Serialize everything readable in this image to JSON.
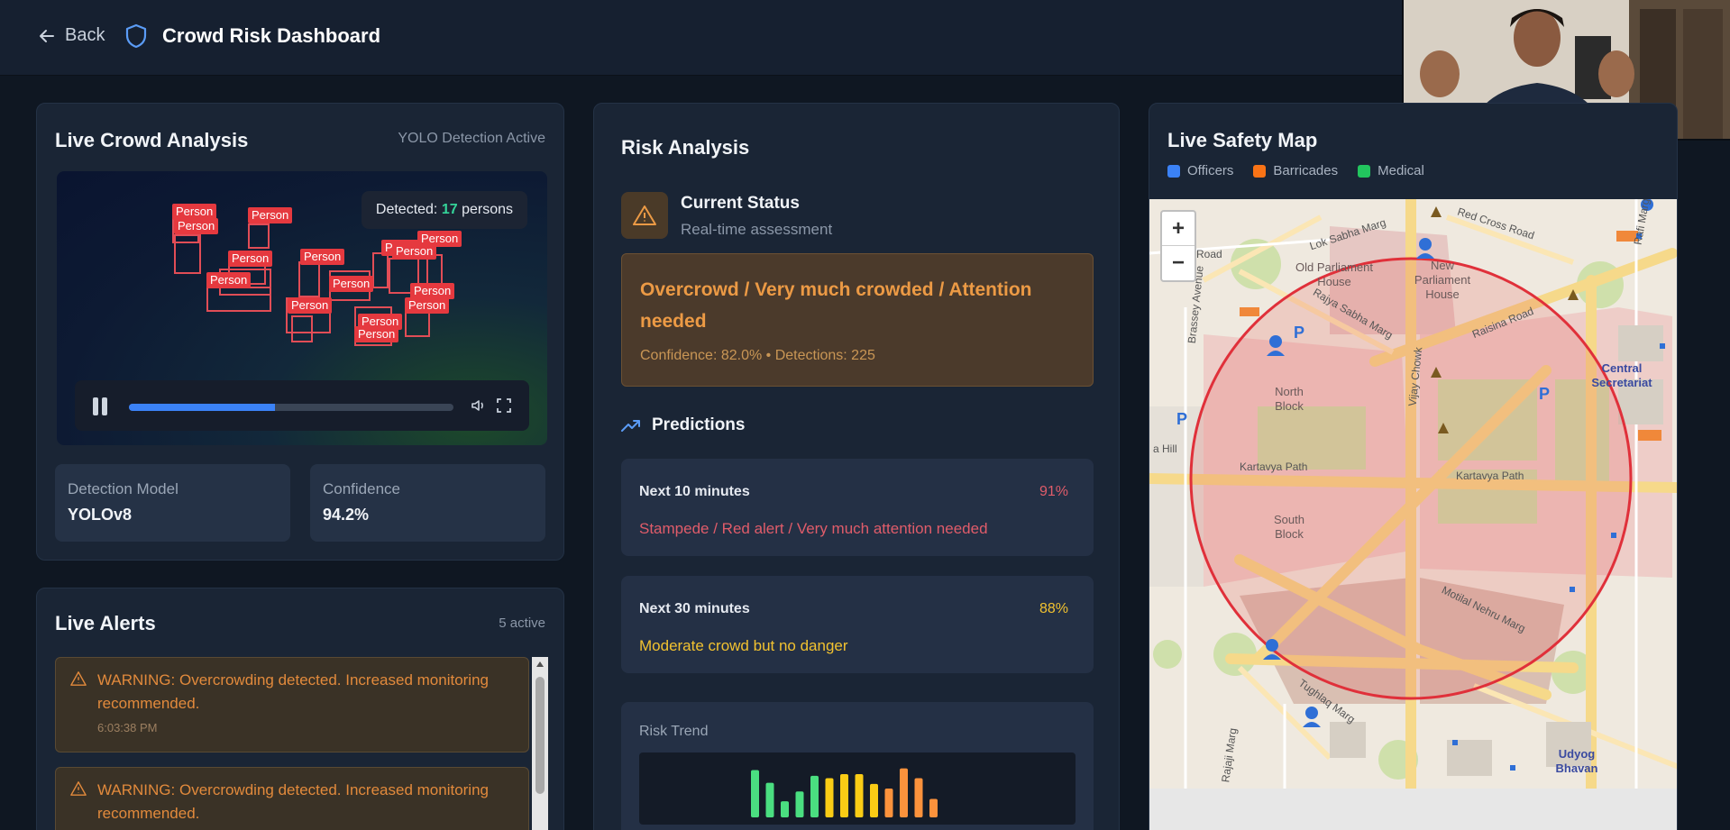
{
  "header": {
    "back_label": "Back",
    "title": "Crowd Risk Dashboard"
  },
  "crowd_analysis": {
    "title": "Live Crowd Analysis",
    "status_tag": "YOLO Detection Active",
    "detected_prefix": "Detected: ",
    "detected_count": "17",
    "detected_suffix": " persons",
    "box_label": "Person",
    "video_progress": 0.45,
    "stats": [
      {
        "label": "Detection Model",
        "value": "YOLOv8"
      },
      {
        "label": "Confidence",
        "value": "94.2%"
      }
    ]
  },
  "alerts": {
    "title": "Live Alerts",
    "count_label": "5 active",
    "items": [
      {
        "text": "WARNING: Overcrowding detected. Increased monitoring recommended.",
        "time": "6:03:38 PM"
      },
      {
        "text": "WARNING: Overcrowding detected. Increased monitoring recommended.",
        "time": ""
      }
    ]
  },
  "risk": {
    "title": "Risk Analysis",
    "current_status_title": "Current Status",
    "current_status_sub": "Real-time assessment",
    "status_text": "Overcrowd / Very much crowded / Attention needed",
    "status_meta": "Confidence: 82.0% • Detections: 225",
    "predictions_title": "Predictions",
    "predictions": [
      {
        "time": "Next 10 minutes",
        "pct": "91%",
        "desc": "Stampede / Red alert / Very much attention needed",
        "color": "#e05c6a",
        "pct_color": "#e05c6a"
      },
      {
        "time": "Next 30 minutes",
        "pct": "88%",
        "desc": "Moderate crowd but no danger",
        "color": "#f2c230",
        "pct_color": "#f2c230"
      }
    ],
    "trend_label": "Risk Trend",
    "trend_values": [
      0.82,
      0.6,
      0.28,
      0.45,
      0.72,
      0.68,
      0.75,
      0.75,
      0.58,
      0.5,
      0.85,
      0.68,
      0.32
    ],
    "trend_colors": [
      "#4ade80",
      "#4ade80",
      "#4ade80",
      "#4ade80",
      "#4ade80",
      "#facc15",
      "#facc15",
      "#facc15",
      "#facc15",
      "#fb923c",
      "#fb923c",
      "#fb923c",
      "#fb923c"
    ]
  },
  "map": {
    "title": "Live Safety Map",
    "legend": [
      {
        "label": "Officers",
        "color": "#3b82f6"
      },
      {
        "label": "Barricades",
        "color": "#f97316"
      },
      {
        "label": "Medical",
        "color": "#22c55e"
      }
    ],
    "zoom_in": "+",
    "zoom_out": "−",
    "places": {
      "old_parliament": "Old Parliament House",
      "new_parliament": "New Parliament House",
      "north_block": "North Block",
      "south_block": "South Block",
      "central_secretariat": "Central Secretariat",
      "udyog_bhavan": "Udyog Bhavan",
      "lok_sabha_marg": "Lok Sabha Marg",
      "red_cross_road": "Red Cross Road",
      "raisina_road": "Raisina Road",
      "rajya_sabha_marg": "Rajya Sabha Marg",
      "vijay_chowk": "Vijay Chowk",
      "kartavya_path": "Kartavya Path",
      "motilal_nehru_marg": "Motilal Nehru Marg",
      "tughlaq_marg": "Tughlaq Marg",
      "rajaji_marg": "Rajaji Marg",
      "brassey_avenue": "Brassey Avenue",
      "road": "Road",
      "rafi_marg": "Rafi Marg",
      "hill": "a Hill"
    }
  }
}
